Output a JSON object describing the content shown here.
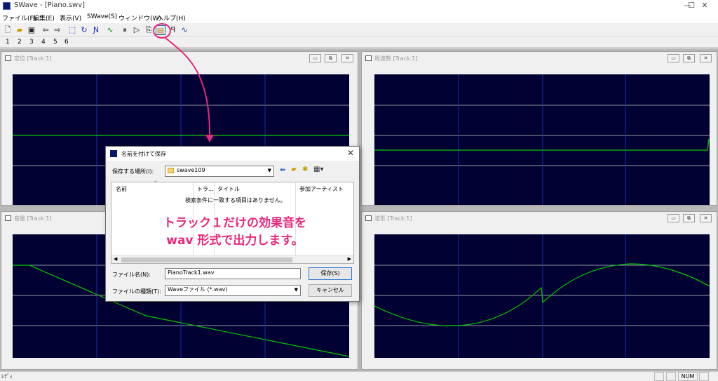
{
  "window": {
    "title": "SWave - [Piano.swv]",
    "min_btn": "—",
    "max_btn": "☐",
    "close_btn": "✕"
  },
  "menu": [
    "ファイル(F)",
    "編集(E)",
    "表示(V)",
    "SWave(S)",
    "ウィンドウ(W)",
    "ヘルプ(H)"
  ],
  "tabs": [
    "1",
    "2",
    "3",
    "4",
    "5",
    "6"
  ],
  "panels": {
    "position": {
      "title": "定位 [Track:1]"
    },
    "frequency": {
      "title": "周波数 [Track:1]"
    },
    "volume": {
      "title": "音量 [Track:1]"
    },
    "waveform": {
      "title": "波形 [Track:1]"
    }
  },
  "panel_buttons": {
    "minimize": "▭",
    "restore": "⧉",
    "close": "✕"
  },
  "dialog": {
    "title": "名前を付けて保存",
    "save_in_label": "保存する場所(I):",
    "save_in_value": "swave109",
    "columns": [
      "名前",
      "トラ...",
      "タイトル",
      "参加アーティスト"
    ],
    "empty_message": "検索条件に一致する項目はありません。",
    "filename_label": "ファイル名(N):",
    "filename_value": "PianoTrack1.wav",
    "filetype_label": "ファイルの種類(T):",
    "filetype_value": "Waveファイル (*.wav)",
    "save_button": "保存(S)",
    "cancel_button": "キャンセル",
    "close_icon": "✕"
  },
  "annotation": {
    "line1": "トラック１だけの効果音を",
    "line2": "wav 形式で出力します。",
    "color": "#e8287a"
  },
  "status": {
    "ready": "ﾚﾃﾞｨ",
    "num": "NUM"
  },
  "colors": {
    "plot_bg": "#000033",
    "trace": "#00cc00",
    "grid_v": "#1a2fa8",
    "grid_h": "#c8c8c8",
    "accent": "#e8287a"
  }
}
